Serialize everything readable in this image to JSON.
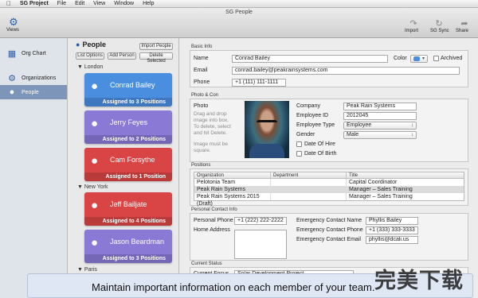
{
  "menubar": {
    "app": "SG Project",
    "items": [
      "File",
      "Edit",
      "View",
      "Window",
      "Help"
    ]
  },
  "window": {
    "title": "SG People"
  },
  "toolbar": {
    "views_label": "Views",
    "right_buttons": [
      {
        "label": "Import",
        "icon": "import-icon"
      },
      {
        "label": "SG Sync",
        "icon": "sync-icon"
      },
      {
        "label": "Share",
        "icon": "share-icon"
      }
    ]
  },
  "sidebar": {
    "items": [
      {
        "label": "Org Chart",
        "icon": "org-chart-icon"
      },
      {
        "label": "Organizations",
        "icon": "gear-icon"
      },
      {
        "label": "People",
        "icon": "person-icon"
      }
    ]
  },
  "people_list": {
    "title": "People",
    "buttons": {
      "import": "Import People",
      "list_options": "List Options",
      "add": "Add Person",
      "delete": "Delete Selected"
    },
    "groups": [
      {
        "name": "London"
      },
      {
        "name": "New York"
      },
      {
        "name": "Paris"
      }
    ],
    "cards": [
      {
        "name": "Conrad Bailey",
        "assign": "Assigned to 3 Positions",
        "color": "#4a8ee0"
      },
      {
        "name": "Jerry Feyes",
        "assign": "Assigned to 2 Positions",
        "color": "#8b79d6"
      },
      {
        "name": "Cam Forsythe",
        "assign": "Assigned to 1 Position",
        "color": "#d94545"
      },
      {
        "name": "Jeff Bailjate",
        "assign": "Assigned to 4 Positions",
        "color": "#d94545"
      },
      {
        "name": "Jason Beardman",
        "assign": "Assigned to 3 Positions",
        "color": "#8b79d6"
      }
    ]
  },
  "detail": {
    "basic_info": {
      "section": "Basic Info",
      "name_label": "Name",
      "name": "Conrad Bailey",
      "color_label": "Color",
      "archived_label": "Archived",
      "email_label": "Email",
      "email": "conrad.bailey@peakrainsystems.com",
      "phone_label": "Phone",
      "phone": "+1 (111) 111-1111"
    },
    "photo_company": {
      "section": "Photo & Con",
      "photo_label": "Photo",
      "photo_hint": [
        "Drag and drop",
        "image into box.",
        "To delete, select",
        "and hit Delete.",
        "",
        "Image must be",
        "square."
      ],
      "company_label": "Company",
      "company": "Peak Rain Systems",
      "employee_id_label": "Employee ID",
      "employee_id": "2012045",
      "employee_type_label": "Employee Type",
      "employee_type": "Employee",
      "gender_label": "Gender",
      "gender": "Male",
      "date_hire_label": "Date Of Hire",
      "date_birth_label": "Date Of Birth"
    },
    "positions": {
      "section": "Positions",
      "columns": [
        "Organization",
        "Department",
        "Title"
      ],
      "rows": [
        {
          "org": "Pelotonia Team",
          "dept": "",
          "title": "Capital Coordinator"
        },
        {
          "org": "Peak Rain Systems",
          "dept": "",
          "title": "Manager – Sales Training"
        },
        {
          "org": "Peak Rain Systems 2015 (Draft)",
          "dept": "",
          "title": "Manager – Sales Training"
        }
      ]
    },
    "personal_contact": {
      "section": "Personal Contact Info",
      "personal_phone_label": "Personal Phone",
      "personal_phone": "+1 (222) 222-2222",
      "home_address_label": "Home Address",
      "ec_name_label": "Emergency Contact Name",
      "ec_name": "Phyllis Bailey",
      "ec_phone_label": "Emergency Contact Phone",
      "ec_phone": "+1 (333) 333-3333",
      "ec_email_label": "Emergency Contact Email",
      "ec_email": "phyllis@dcali.us"
    },
    "current_status": {
      "section": "Current Status",
      "focus_label": "Current Focus",
      "focus": "Solar Development Project"
    }
  },
  "caption": {
    "text": "Maintain important information on each member of your team."
  },
  "watermark": {
    "text": "完美下载"
  }
}
